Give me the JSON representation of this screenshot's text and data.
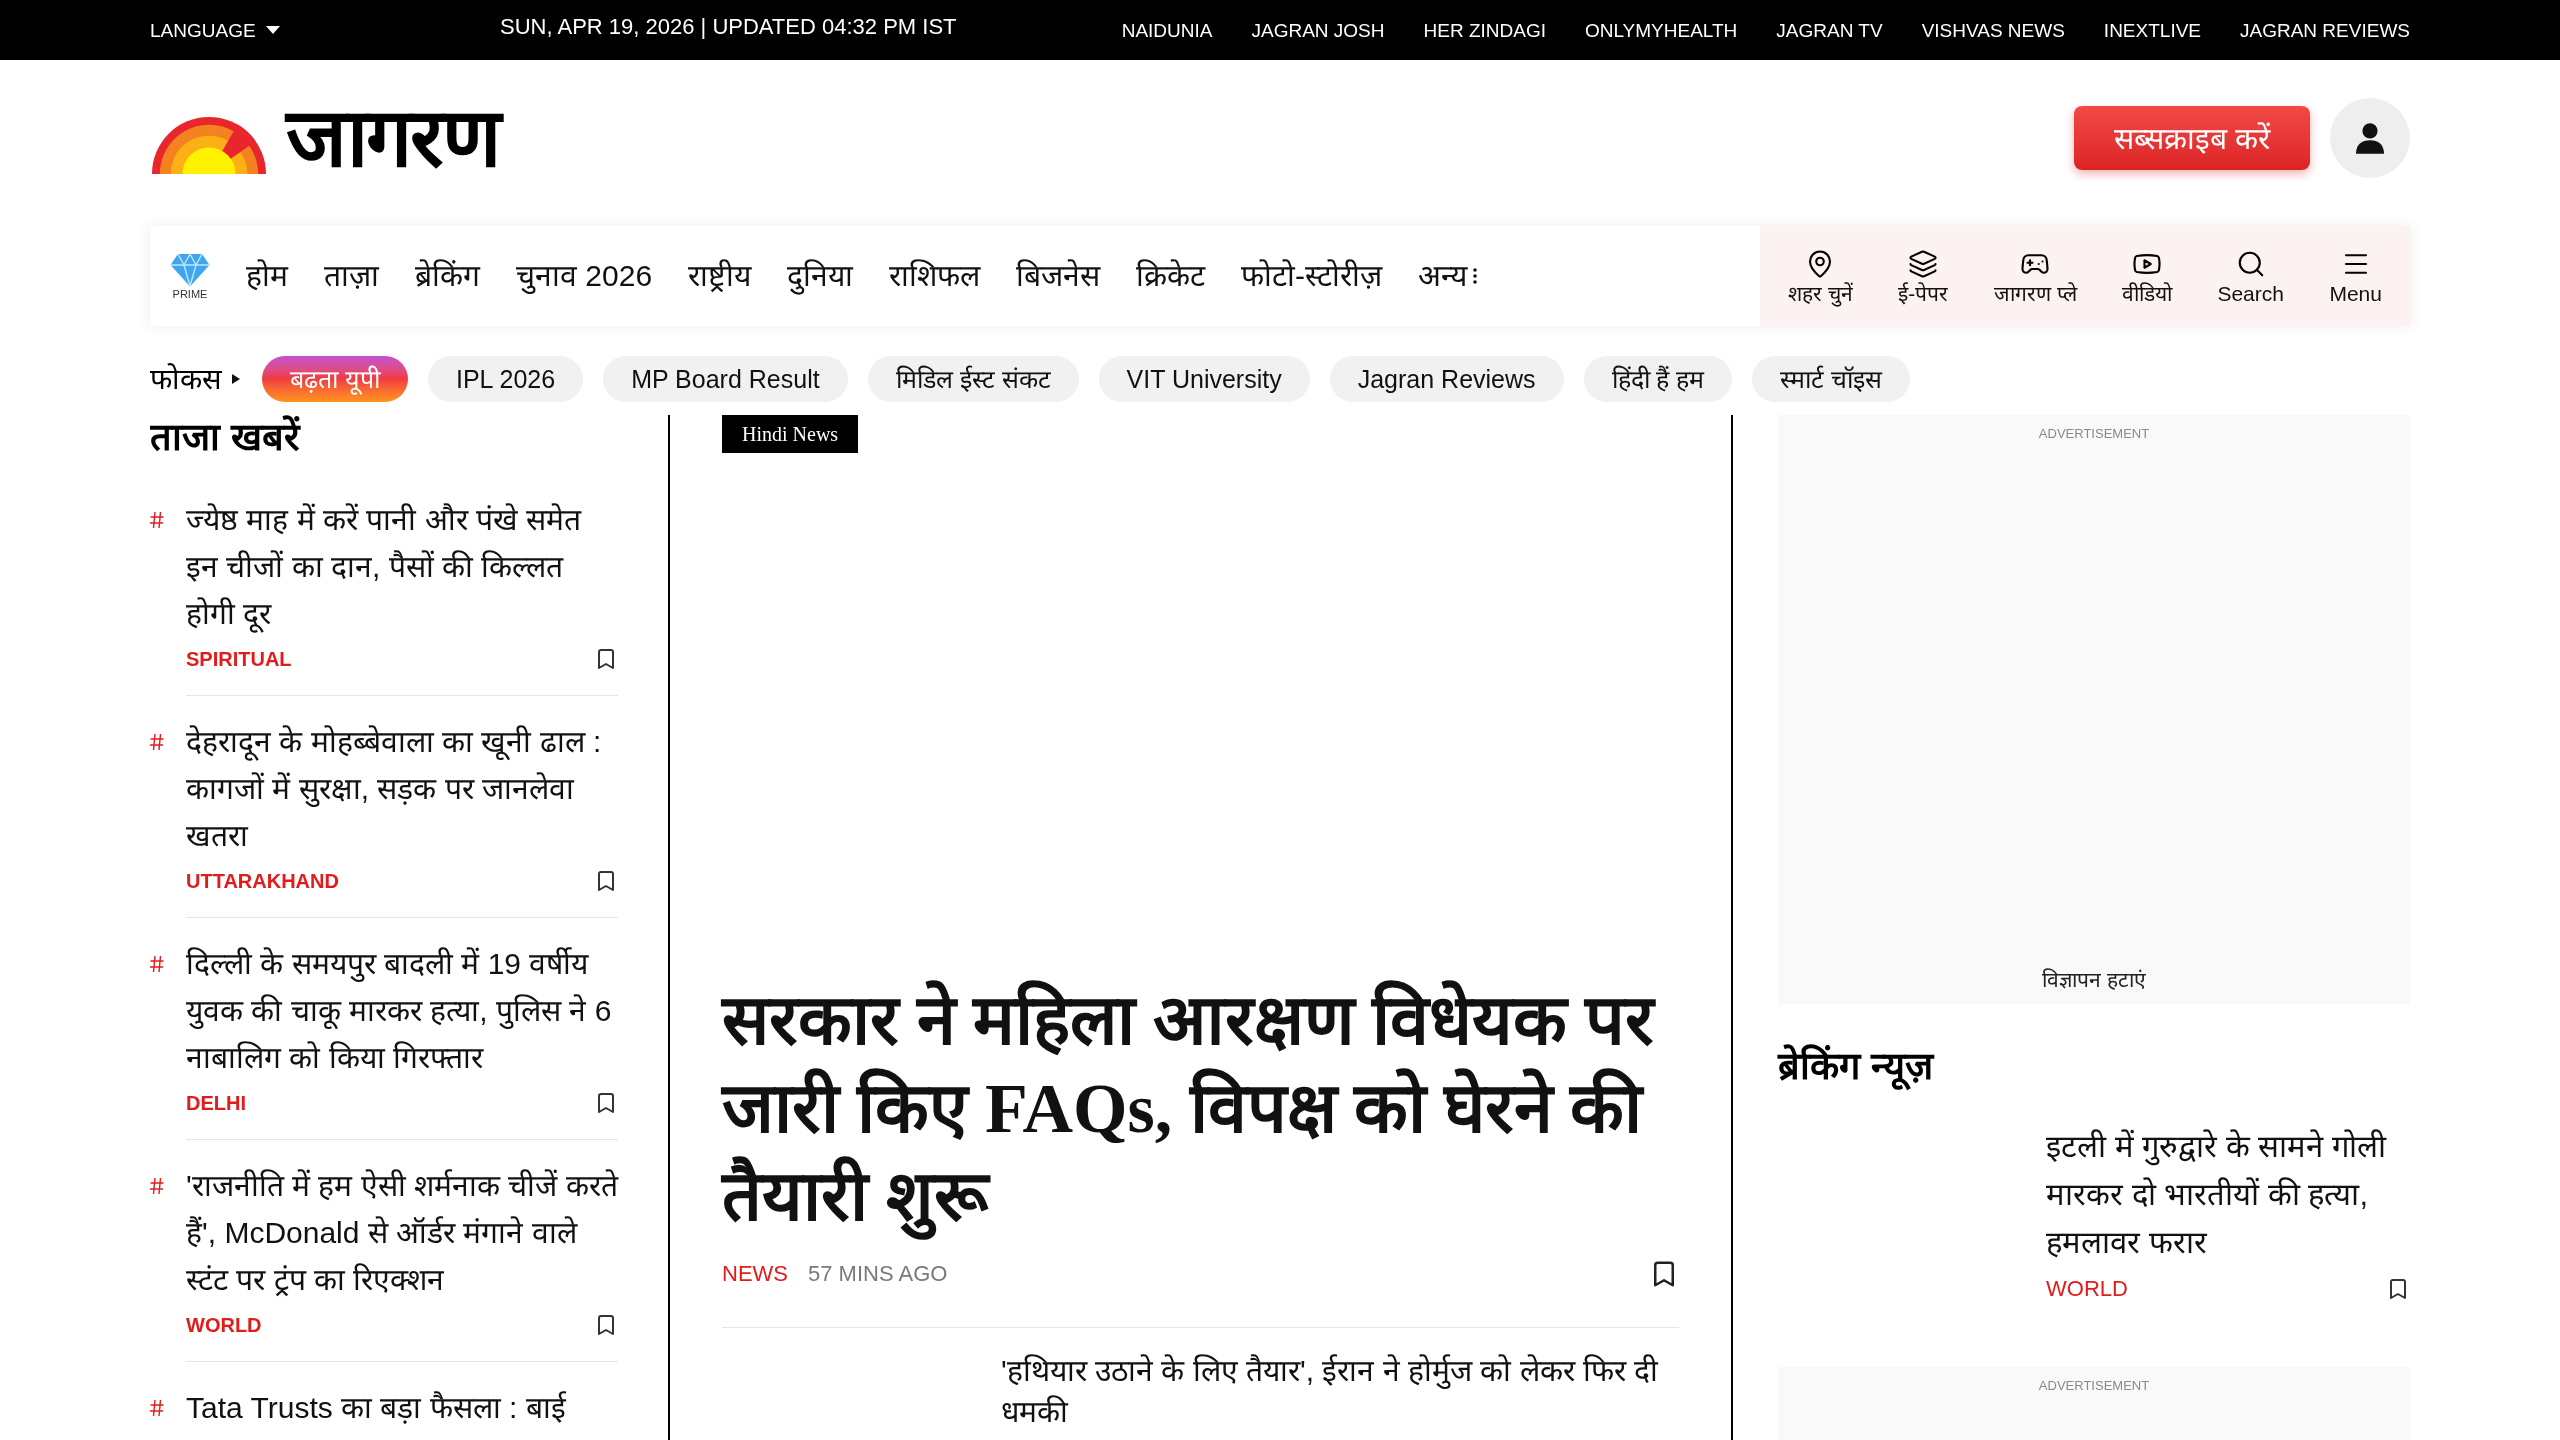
{
  "top_bar": {
    "language": "LANGUAGE",
    "date": "SUN, APR 19, 2026 | UPDATED 04:32 PM IST",
    "links": [
      "NAIDUNIA",
      "JAGRAN JOSH",
      "HER ZINDAGI",
      "ONLYMYHEALTH",
      "JAGRAN TV",
      "VISHVAS NEWS",
      "INEXTLIVE",
      "JAGRAN REVIEWS"
    ]
  },
  "header": {
    "logo": "जागरण",
    "subscribe_button": "सब्सक्राइब करें"
  },
  "nav": {
    "prime": "PRIME",
    "items": [
      "होम",
      "ताज़ा",
      "ब्रेकिंग",
      "चुनाव 2026",
      "राष्ट्रीय",
      "दुनिया",
      "राशिफल",
      "बिजनेस",
      "क्रिकेट",
      "फोटो-स्टोरीज़"
    ],
    "more": "अन्य",
    "tools": [
      {
        "kind": "location",
        "label": "शहर चुनें"
      },
      {
        "kind": "epaper",
        "label": "ई-पेपर"
      },
      {
        "kind": "game",
        "label": "जागरण प्ले"
      },
      {
        "kind": "video",
        "label": "वीडियो"
      },
      {
        "kind": "search",
        "label": "Search"
      },
      {
        "kind": "menu",
        "label": "Menu"
      }
    ]
  },
  "focus": {
    "label": "फोकस",
    "tags": [
      {
        "label": "बढ़ता यूपी",
        "highlighted": true
      },
      {
        "label": "IPL 2026",
        "highlighted": false
      },
      {
        "label": "MP Board Result",
        "highlighted": false
      },
      {
        "label": "मिडिल ईस्ट संकट",
        "highlighted": false
      },
      {
        "label": "VIT University",
        "highlighted": false
      },
      {
        "label": "Jagran Reviews",
        "highlighted": false
      },
      {
        "label": "हिंदी हैं हम",
        "highlighted": false
      },
      {
        "label": "स्मार्ट चॉइस",
        "highlighted": false
      }
    ]
  },
  "latest": {
    "title": "ताजा खबरें",
    "items": [
      {
        "headline": "ज्येष्ठ माह में करें पानी और पंखे समेत इन चीजों का दान, पैसों की किल्लत होगी दूर",
        "category": "SPIRITUAL"
      },
      {
        "headline": "देहरादून के मोहब्बेवाला का खूनी ढाल : कागजों में सुरक्षा, सड़क पर जानलेवा खतरा",
        "category": "UTTARAKHAND"
      },
      {
        "headline": "दिल्ली के समयपुर बादली में 19 वर्षीय युवक की चाकू मारकर हत्या, पुलिस ने 6 नाबालिग को किया गिरफ्तार",
        "category": "DELHI"
      },
      {
        "headline": "'राजनीति में हम ऐसी शर्मनाक चीजें करते हैं', McDonald से ऑर्डर मंगाने वाले स्टंट पर ट्रंप का रिएक्शन",
        "category": "WORLD"
      },
      {
        "headline": "Tata Trusts का बड़ा फैसला : बाई"
      }
    ]
  },
  "lead": {
    "badge": "Hindi News",
    "headline": "सरकार ने महिला आरक्षण विधेयक पर जारी किए FAQs, विपक्ष को घेरने की तैयारी शुरू",
    "category": "NEWS",
    "time": "57 MINS AGO"
  },
  "second_story": {
    "headline": "'हथियार उठाने के लिए तैयार', ईरान ने होर्मुज को लेकर फिर दी धमकी"
  },
  "ad": {
    "label": "ADVERTISEMENT",
    "remove_link": "विज्ञापन हटाएं"
  },
  "breaking": {
    "title": "ब्रेकिंग न्यूज़",
    "items": [
      {
        "headline": "इटली में गुरुद्वारे के सामने गोली मारकर दो भारतीयों की हत्या, हमलावर फरार",
        "category": "WORLD"
      }
    ]
  },
  "ad_bottom": {
    "label": "ADVERTISEMENT"
  }
}
